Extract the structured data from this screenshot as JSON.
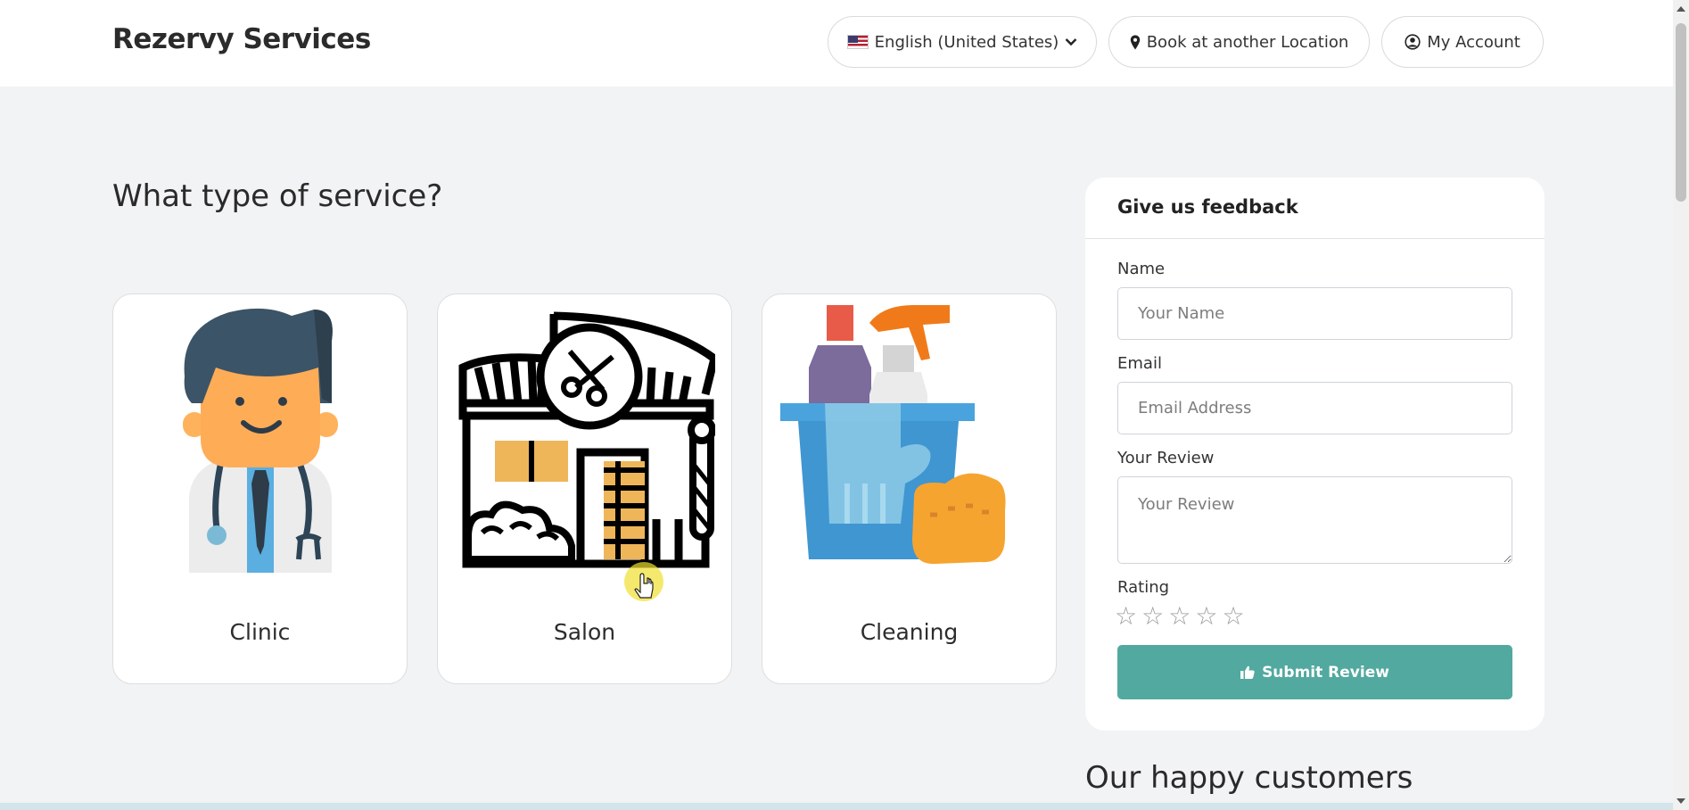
{
  "header": {
    "brand": "Rezervy Services",
    "language": {
      "label": "English (United States)",
      "flag_icon": "us-flag-icon",
      "chevron_icon": "chevron-down-icon"
    },
    "location_button": {
      "label": "Book at another Location",
      "icon": "map-pin-icon"
    },
    "account_button": {
      "label": "My Account",
      "icon": "user-circle-icon"
    }
  },
  "services": {
    "heading": "What type of service?",
    "items": [
      {
        "label": "Clinic",
        "icon": "doctor-illustration"
      },
      {
        "label": "Salon",
        "icon": "salon-storefront-illustration"
      },
      {
        "label": "Cleaning",
        "icon": "cleaning-supplies-illustration"
      }
    ]
  },
  "feedback": {
    "title": "Give us feedback",
    "name_label": "Name",
    "name_placeholder": "Your Name",
    "email_label": "Email",
    "email_placeholder": "Email Address",
    "review_label": "Your Review",
    "review_placeholder": "Your Review",
    "rating_label": "Rating",
    "rating_value": 0,
    "rating_max": 5,
    "submit_label": "Submit Review",
    "submit_icon": "thumbs-up-icon"
  },
  "customers": {
    "heading": "Our happy customers"
  },
  "colors": {
    "accent": "#52a99f",
    "page_bg": "#f2f3f4",
    "header_bg": "#ffffff"
  }
}
